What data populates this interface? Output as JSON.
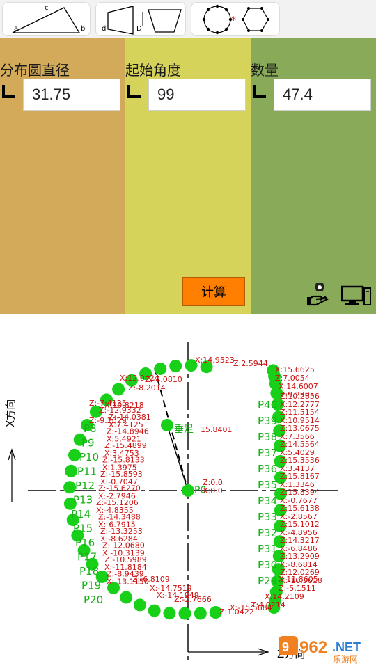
{
  "toolbar": {
    "triangle": {
      "a": "a",
      "b": "b",
      "c": "c"
    },
    "trapezoid": {
      "d": "d",
      "D": "D"
    }
  },
  "params": [
    {
      "label": "分布圆直径",
      "value": "31.75"
    },
    {
      "label": "起始角度",
      "value": "99"
    },
    {
      "label": "数量",
      "value": "47.4"
    }
  ],
  "actions": {
    "calc_label": "计算"
  },
  "plot": {
    "x_axis_label": "X方向",
    "z_axis_label": "Z方向",
    "center_label": "P0",
    "center_z": "Z:0.0",
    "center_x": "X:0.0",
    "foot_label": "垂足",
    "foot_value": "15.8401",
    "colors": {
      "point": "#18d018",
      "text_red": "#cc1111",
      "text_green": "#18b018",
      "axis": "#000000"
    },
    "left_points": [
      {
        "p": "P8",
        "z": "Z:-14.0381",
        "x": "X:7.4125"
      },
      {
        "p": "P9",
        "z": "Z:-14.8946",
        "x": "X:5.4921"
      },
      {
        "p": "P10",
        "z": "Z:-15.4899",
        "x": "X:3.4753"
      },
      {
        "p": "P11",
        "z": "Z:-15.8133",
        "x": "X:1.3975"
      },
      {
        "p": "P12",
        "z": "Z:-15.8593",
        "x": "X:-0.7047"
      },
      {
        "p": "P13",
        "z": "Z:-15.6270",
        "x": "X:-2.7946"
      },
      {
        "p": "P14",
        "z": "Z:-15.1206",
        "x": "X:-4.8355"
      },
      {
        "p": "P15",
        "z": "Z:-14.3488",
        "x": "X:-6.7915"
      },
      {
        "p": "P16",
        "z": "Z:-13.3253",
        "x": "X:-8.6284"
      },
      {
        "p": "P17",
        "z": "Z:-12.0680",
        "x": "X:-10.3139"
      },
      {
        "p": "P18",
        "z": "Z:-10.5989",
        "x": "X:-11.8184"
      },
      {
        "p": "P19",
        "z": "Z:-8.9439",
        "x": "X:-13.1150"
      },
      {
        "p": "P20",
        "z": "",
        "x": ""
      }
    ],
    "right_points": [
      {
        "p": "P40",
        "z": "Z:10.2856",
        "x": "X:12.2777"
      },
      {
        "p": "P39",
        "z": "Z:11.5154",
        "x": "X:10.9514"
      },
      {
        "p": "P38",
        "z": "Z:13.0675",
        "x": "X:7.3566"
      },
      {
        "p": "P37",
        "z": "Z:14.5564",
        "x": "X:5.4029"
      },
      {
        "p": "P36",
        "z": "Z:15.3536",
        "x": "X:3.4137"
      },
      {
        "p": "P35",
        "z": "Z:15.8167",
        "x": "X:1.3346"
      },
      {
        "p": "P34",
        "z": "Z:15.8394",
        "x": "X:-0.7677"
      },
      {
        "p": "P33",
        "z": "Z:15.6138",
        "x": "X:-2.8567"
      },
      {
        "p": "P32",
        "z": "Z:15.1012",
        "x": "X:-4.8956"
      },
      {
        "p": "P31",
        "z": "Z:14.3217",
        "x": "X:-6.8486"
      },
      {
        "p": "P30",
        "z": "Z:13.2909",
        "x": "X:-8.6814"
      },
      {
        "p": "P29",
        "z": "Z:12.0269",
        "x": "X:-10.3618"
      }
    ],
    "extra_labels": [
      {
        "t": "Z:-7.4125",
        "k": "tl1"
      },
      {
        "t": "Z:-8.2014",
        "k": "tl2"
      },
      {
        "t": "X:12.0424",
        "k": "tl3"
      },
      {
        "t": "X:10.8218",
        "k": "tl4"
      },
      {
        "t": "Z:-12.9332",
        "k": "tl5"
      },
      {
        "t": "Z:-9.2029",
        "k": "tl6"
      },
      {
        "t": "Z:-4.0810",
        "k": "tl7"
      },
      {
        "t": "X:14.9523",
        "k": "top1"
      },
      {
        "t": "Z:2.5944",
        "k": "top2"
      },
      {
        "t": "X:15.6625",
        "k": "top3"
      },
      {
        "t": "Z:7.0054",
        "k": "tr1"
      },
      {
        "t": "X:14.6007",
        "k": "tr2"
      },
      {
        "t": "Z:9.2305",
        "k": "tr3"
      },
      {
        "t": "X:11.8605",
        "k": "br1"
      },
      {
        "t": "Z:-5.1511",
        "k": "br2"
      },
      {
        "t": "X:14.2109",
        "k": "br3"
      },
      {
        "t": "Z:4.0214",
        "k": "b1"
      },
      {
        "t": "X:-15.5684",
        "k": "b2"
      },
      {
        "t": "Z:1.0422",
        "k": "b3"
      },
      {
        "t": "X:-14.1949",
        "k": "bl1"
      },
      {
        "t": "Z:-2.7666",
        "k": "bl2"
      },
      {
        "t": "X:-14.7519",
        "k": "bl3"
      },
      {
        "t": "Z:-6.8109",
        "k": "bl4"
      }
    ]
  },
  "watermark": {
    "brand": "962",
    "suffix": ".NET",
    "sub": "乐游网"
  }
}
